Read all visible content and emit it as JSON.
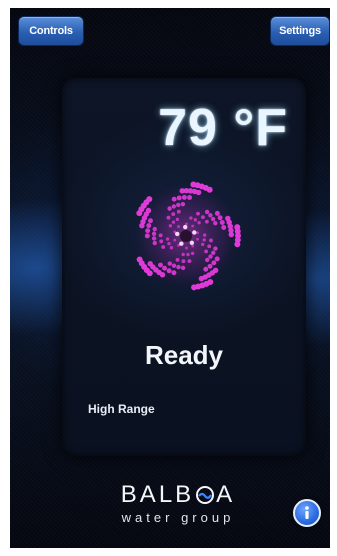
{
  "header": {
    "controls_label": "Controls",
    "settings_label": "Settings"
  },
  "status_panel": {
    "temperature": "79 °F",
    "status": "Ready",
    "range": "High Range"
  },
  "brand": {
    "name_prefix": "BALB",
    "name_suffix": "A",
    "tagline": "water group"
  },
  "icons": {
    "jets": "swirl-jets-icon",
    "info": "info-icon",
    "logo_o": "wave-o-logo-icon"
  },
  "colors": {
    "accent_blue": "#2a5fb3",
    "swirl_magenta": "#e03ad8",
    "temp_glow": "#e9f6ff"
  }
}
